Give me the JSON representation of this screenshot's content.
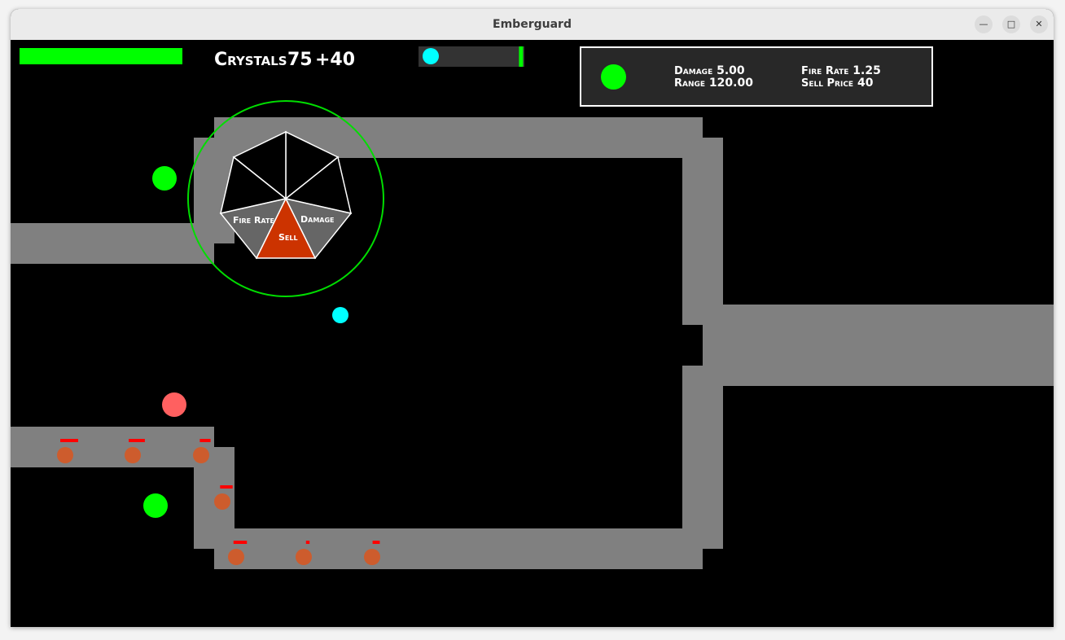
{
  "window": {
    "title": "Emberguard",
    "minimize_icon": "minimize-icon",
    "maximize_icon": "maximize-icon",
    "close_icon": "close-icon"
  },
  "hud": {
    "health_fraction": 1.0,
    "crystals_label": "Crystals",
    "crystals_value": "75",
    "crystals_gain": "+40",
    "wave_progress_fraction": 0.98
  },
  "info_panel": {
    "damage_label": "Damage",
    "damage_value": "5.00",
    "range_label": "Range",
    "range_value": "120.00",
    "fire_rate_label": "Fire Rate",
    "fire_rate_value": "1.25",
    "sell_price_label": "Sell Price",
    "sell_price_value": "40"
  },
  "radial_menu": {
    "fire_rate_label": "Fire Rate",
    "damage_label": "Damage",
    "sell_label": "Sell"
  },
  "enemy_health_fractions": [
    1.0,
    0.9,
    0.6,
    0.7,
    0.75,
    0.2,
    0.4
  ],
  "colors": {
    "path": "#808080",
    "tower": "#00ff00",
    "frost_tower": "#00ffff",
    "enemy": "#cd5c2d",
    "enemy_health": "#ff0000",
    "selected_range": "#00dd00",
    "sell_wedge": "#cc3300",
    "upgrade_wedge": "#666666",
    "pending_tower": "#ff6060"
  }
}
